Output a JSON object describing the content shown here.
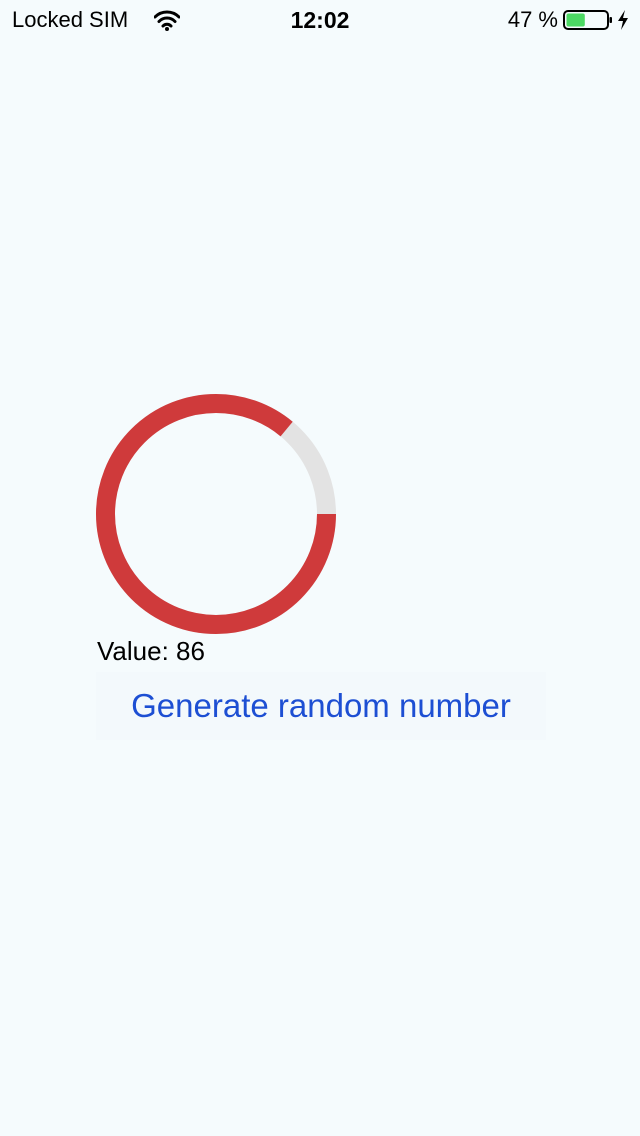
{
  "status_bar": {
    "carrier": "Locked SIM",
    "time": "12:02",
    "battery_percent": "47 %",
    "battery_level": 0.47,
    "icons": [
      "wifi-icon",
      "battery-icon",
      "charging-bolt-icon"
    ]
  },
  "gauge": {
    "value": 86,
    "max": 100,
    "fill_color": "#cf3a3b",
    "track_color": "#e3e3e3"
  },
  "value_label": {
    "prefix": "Value:",
    "value": "86"
  },
  "generate_button": {
    "label": "Generate random number",
    "color": "#1d4fd3"
  }
}
